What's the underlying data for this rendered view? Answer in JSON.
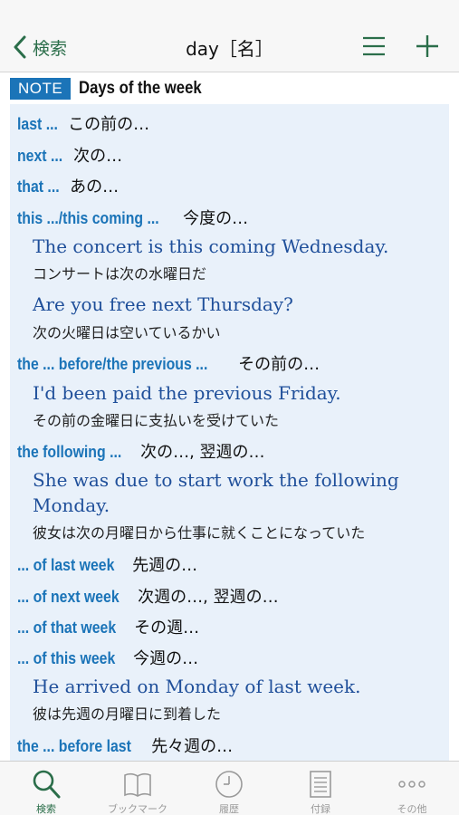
{
  "nav": {
    "back_label": "検索",
    "title": "day［名］"
  },
  "note": {
    "badge": "NOTE",
    "title": "Days of the week"
  },
  "entries": [
    {
      "term": "last ...",
      "gloss": "この前の…"
    },
    {
      "term": "next ...",
      "gloss": "次の…"
    },
    {
      "term": "that ...",
      "gloss": "あの…"
    },
    {
      "term": "this .../this coming ...",
      "gloss": "今度の…"
    },
    {
      "term": "the ... before/the previous ...",
      "gloss": "その前の…"
    },
    {
      "term": "the following ...",
      "gloss": "次の…, 翌週の…"
    },
    {
      "term": "... of last week",
      "gloss": "先週の…"
    },
    {
      "term": "... of next week",
      "gloss": "次週の…, 翌週の…"
    },
    {
      "term": "... of that week",
      "gloss": "その週…"
    },
    {
      "term": "... of this week",
      "gloss": "今週の…"
    },
    {
      "term": "the ... before last",
      "gloss": "先々週の…"
    }
  ],
  "examples": [
    {
      "en": "The concert is this coming Wednesday.",
      "ja": "コンサートは次の水曜日だ"
    },
    {
      "en": "Are you free next Thursday?",
      "ja": "次の火曜日は空いているかい"
    },
    {
      "en": "I'd been paid the previous Friday.",
      "ja": "その前の金曜日に支払いを受けていた"
    },
    {
      "en": "She was due to start work the following Monday.",
      "ja": "彼女は次の月曜日から仕事に就くことになっていた"
    },
    {
      "en": "He arrived on Monday of last week.",
      "ja": "彼は先週の月曜日に到着した"
    }
  ],
  "tabs": [
    {
      "label": "検索",
      "icon": "search-icon",
      "active": true
    },
    {
      "label": "ブックマーク",
      "icon": "book-icon",
      "active": false
    },
    {
      "label": "履歴",
      "icon": "clock-icon",
      "active": false
    },
    {
      "label": "付録",
      "icon": "document-icon",
      "active": false
    },
    {
      "label": "その他",
      "icon": "more-icon",
      "active": false
    }
  ],
  "colors": {
    "accent_green": "#2b6e4a",
    "term_blue": "#1b74b8",
    "example_blue": "#1f4f9a",
    "panel_bg": "#e9f1fa"
  }
}
